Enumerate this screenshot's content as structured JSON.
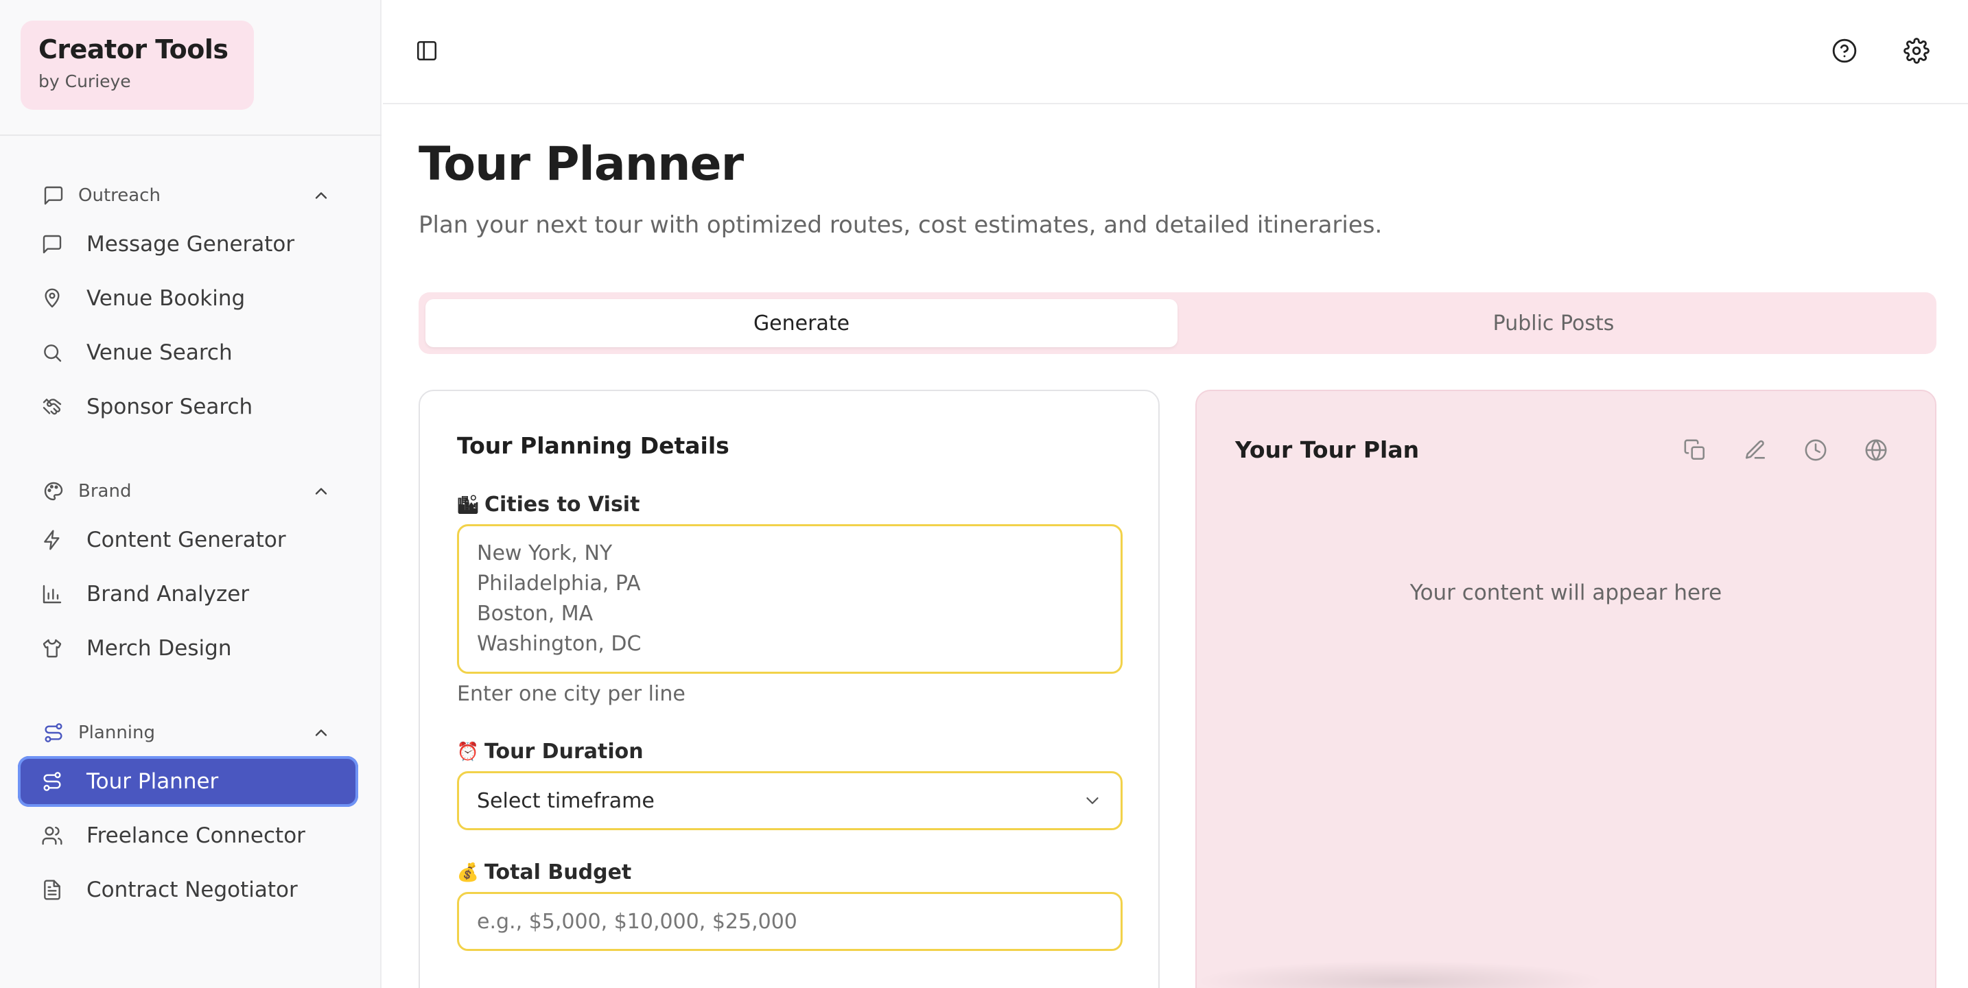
{
  "brand": {
    "title": "Creator Tools",
    "subtitle": "by Curieye"
  },
  "sidebar": {
    "groups": [
      {
        "label": "Outreach",
        "icon": "message-square-icon",
        "items": [
          {
            "label": "Message Generator",
            "icon": "message-square-icon"
          },
          {
            "label": "Venue Booking",
            "icon": "map-pin-icon"
          },
          {
            "label": "Venue Search",
            "icon": "search-icon"
          },
          {
            "label": "Sponsor Search",
            "icon": "handshake-icon"
          }
        ]
      },
      {
        "label": "Brand",
        "icon": "palette-icon",
        "items": [
          {
            "label": "Content Generator",
            "icon": "zap-icon"
          },
          {
            "label": "Brand Analyzer",
            "icon": "bar-chart-icon"
          },
          {
            "label": "Merch Design",
            "icon": "shirt-icon"
          }
        ]
      },
      {
        "label": "Planning",
        "icon": "route-icon",
        "items": [
          {
            "label": "Tour Planner",
            "icon": "route-icon",
            "active": true
          },
          {
            "label": "Freelance Connector",
            "icon": "users-icon"
          },
          {
            "label": "Contract Negotiator",
            "icon": "file-text-icon"
          }
        ]
      }
    ]
  },
  "topbar": {
    "left_icon": "sidebar-toggle-icon",
    "right_icons": [
      "help-circle-icon",
      "settings-gear-icon"
    ]
  },
  "page": {
    "title": "Tour Planner",
    "subtitle": "Plan your next tour with optimized routes, cost estimates, and detailed itineraries."
  },
  "tabs": [
    {
      "label": "Generate",
      "active": true
    },
    {
      "label": "Public Posts",
      "active": false
    }
  ],
  "form": {
    "title": "Tour Planning Details",
    "cities": {
      "emoji": "🏙",
      "label": "Cities to Visit",
      "placeholder": "New York, NY\nPhiladelphia, PA\nBoston, MA\nWashington, DC",
      "helper": "Enter one city per line"
    },
    "duration": {
      "emoji": "⏰",
      "label": "Tour Duration",
      "value": "Select timeframe"
    },
    "budget": {
      "emoji": "💰",
      "label": "Total Budget",
      "placeholder": "e.g., $5,000, $10,000, $25,000"
    }
  },
  "output": {
    "title": "Your Tour Plan",
    "icons": [
      "copy-icon",
      "edit-pencil-icon",
      "history-clock-icon",
      "globe-icon"
    ],
    "placeholder": "Your content will appear here"
  },
  "colors": {
    "accent": "#4a57c0",
    "accent_ring": "#6f93f5",
    "brand_bg": "#fbe3ec",
    "tab_bg": "#fbe4ea",
    "output_bg": "#f9e5ea",
    "field_border": "#f2d24a"
  }
}
